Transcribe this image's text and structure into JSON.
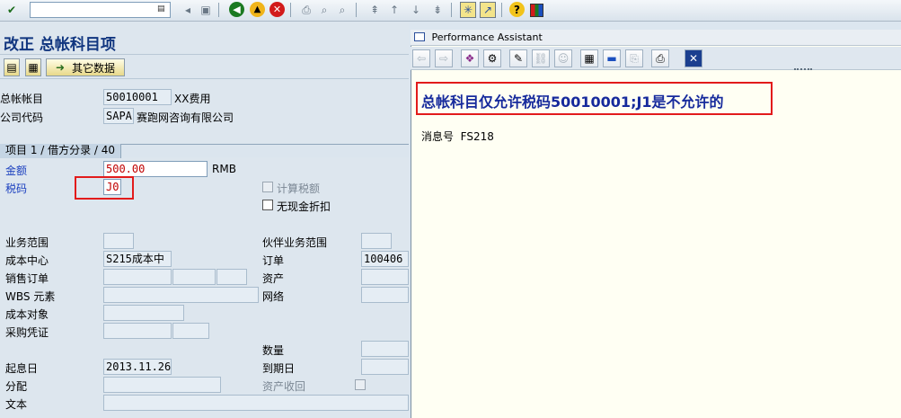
{
  "toolbar": {
    "command_value": "",
    "icons": [
      "check-icon",
      "save-icon",
      "back-icon",
      "exit-icon",
      "cancel-icon",
      "print-icon",
      "find-icon",
      "find-next-icon",
      "first-page-icon",
      "prev-page-icon",
      "next-page-icon",
      "last-page-icon",
      "create-session-icon",
      "shortcut-icon",
      "help-icon",
      "customize-icon"
    ]
  },
  "page": {
    "title": "改正 总帐科目项"
  },
  "app_toolbar": {
    "other_data_label": "其它数据"
  },
  "header": {
    "gl_account_label": "总帐帐目",
    "gl_account_value": "50010001",
    "gl_account_desc": "XX费用",
    "company_code_label": "公司代码",
    "company_code_value": "SAPA",
    "company_code_desc": "赛跑网咨询有限公司"
  },
  "item": {
    "section_title": "项目 1 / 借方分录 / 40",
    "amount_label": "金额",
    "amount_value": "500.00",
    "currency": "RMB",
    "tax_code_label": "税码",
    "tax_code_value": "J0",
    "calc_tax_label": "计算税额",
    "no_discount_label": "无现金折扣",
    "business_area_label": "业务范围",
    "business_area_value": "",
    "partner_ba_label": "伙伴业务范围",
    "partner_ba_value": "",
    "cost_center_label": "成本中心",
    "cost_center_value": "S215成本中",
    "order_label": "订单",
    "order_value": "100406",
    "sales_order_label": "销售订单",
    "asset_label": "资产",
    "wbs_label": "WBS 元素",
    "network_label": "网络",
    "cost_object_label": "成本对象",
    "purchasing_doc_label": "采购凭证",
    "quantity_label": "数量",
    "baseline_date_label": "起息日",
    "baseline_date_value": "2013.11.26",
    "due_date_label": "到期日",
    "assignment_label": "分配",
    "asset_retirement_label": "资产收回",
    "text_label": "文本"
  },
  "assistant": {
    "window_title": "Performance Assistant",
    "message": "总帐科目仅允许税码50010001;J1是不允许的",
    "message_no_label": "消息号",
    "message_no": "FS218",
    "icons": [
      "back-arrow-icon",
      "forward-arrow-icon",
      "book-icon",
      "technical-info-icon",
      "edit-icon",
      "link-icon",
      "users-icon",
      "table-icon",
      "note-icon",
      "print-preview-icon",
      "print-icon",
      "close-icon"
    ]
  }
}
